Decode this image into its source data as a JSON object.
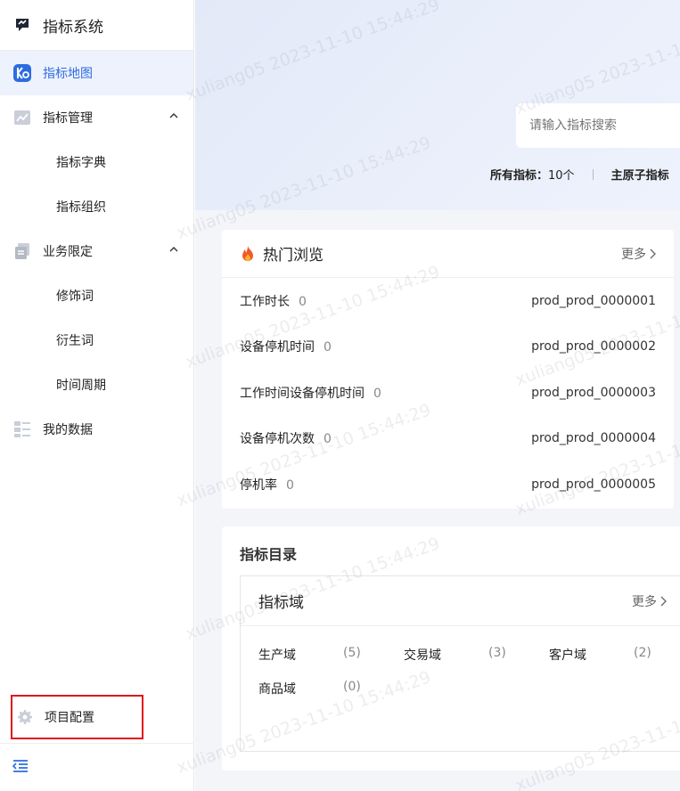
{
  "app": {
    "title": "指标系统"
  },
  "sidebar": {
    "items": [
      {
        "label": "指标地图",
        "active": true
      },
      {
        "label": "指标管理",
        "expanded": true,
        "children": [
          "指标字典",
          "指标组织"
        ]
      },
      {
        "label": "业务限定",
        "expanded": true,
        "children": [
          "修饰词",
          "衍生词",
          "时间周期"
        ]
      },
      {
        "label": "我的数据"
      }
    ],
    "project_config": "项目配置"
  },
  "search": {
    "placeholder": "请输入指标搜索"
  },
  "stats": {
    "all_label": "所有指标：",
    "all_value": "10个",
    "secondary_label": "主原子指标"
  },
  "hot": {
    "title": "热门浏览",
    "more": "更多",
    "rows": [
      {
        "name": "工作时长",
        "count": "0",
        "code": "prod_prod_0000001"
      },
      {
        "name": "设备停机时间",
        "count": "0",
        "code": "prod_prod_0000002"
      },
      {
        "name": "工作时间设备停机时间",
        "count": "0",
        "code": "prod_prod_0000003"
      },
      {
        "name": "设备停机次数",
        "count": "0",
        "code": "prod_prod_0000004"
      },
      {
        "name": "停机率",
        "count": "0",
        "code": "prod_prod_0000005"
      }
    ]
  },
  "catalog": {
    "title": "指标目录",
    "domain_title": "指标域",
    "more": "更多",
    "domains": [
      {
        "name": "生产域",
        "count": "(5)"
      },
      {
        "name": "交易域",
        "count": "(3)"
      },
      {
        "name": "客户域",
        "count": "(2)"
      },
      {
        "name": "商品域",
        "count": "(0)"
      }
    ]
  },
  "watermark": "xuliang05 2023-11-10 15:44:29",
  "colors": {
    "accent": "#2d6ce0",
    "highlight_border": "#e0141a"
  }
}
